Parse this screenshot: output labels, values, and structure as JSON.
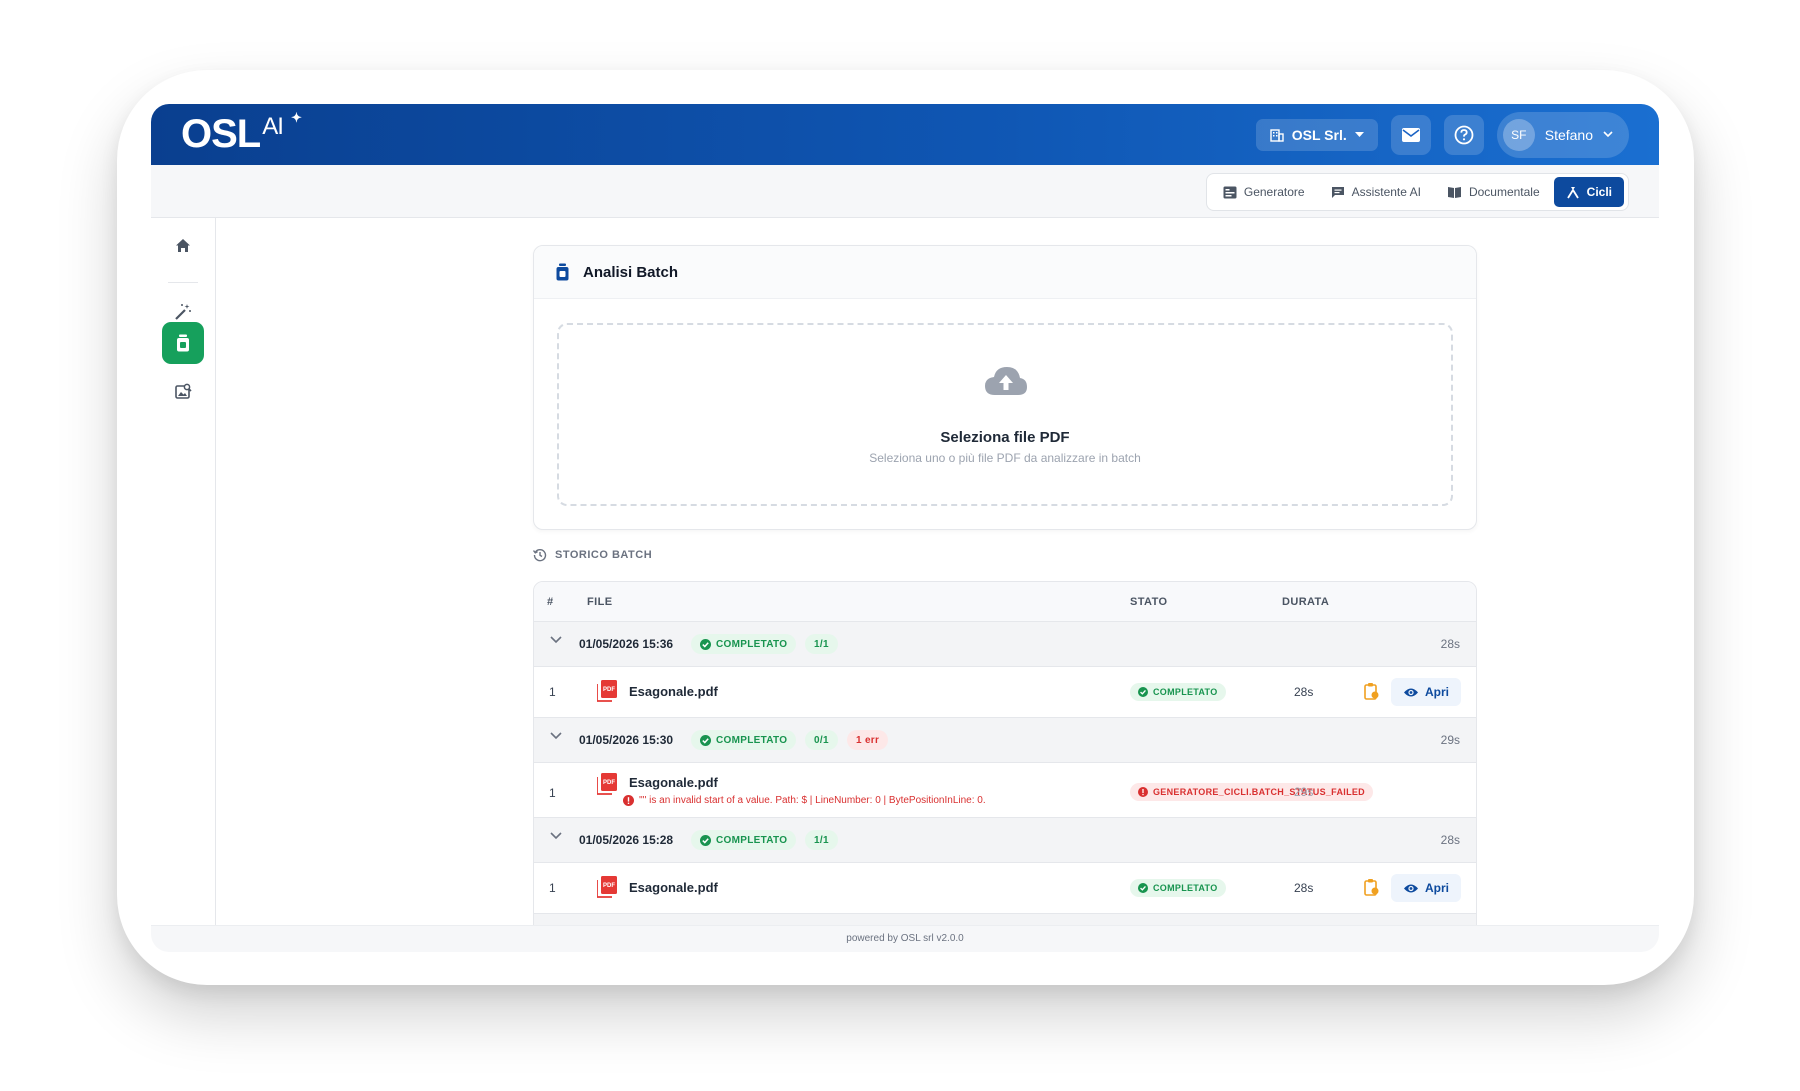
{
  "header": {
    "logo_text": "OSL",
    "logo_sup": "AI",
    "company": "OSL Srl.",
    "user_initials": "SF",
    "user_name": "Stefano"
  },
  "modes": [
    {
      "label": "Generatore",
      "icon": "form-icon",
      "active": false
    },
    {
      "label": "Assistente AI",
      "icon": "chat-icon",
      "active": false
    },
    {
      "label": "Documentale",
      "icon": "book-icon",
      "active": false
    },
    {
      "label": "Cicli",
      "icon": "cycle-icon",
      "active": true
    }
  ],
  "sidebar": {
    "items": [
      {
        "icon": "home-icon"
      },
      {
        "icon": "magic-wand-icon"
      },
      {
        "icon": "batch-icon",
        "active": true
      },
      {
        "icon": "image-search-icon"
      }
    ]
  },
  "card": {
    "title": "Analisi Batch",
    "upload_title": "Seleziona file PDF",
    "upload_subtitle": "Seleziona uno o più file PDF da analizzare in batch"
  },
  "history": {
    "title": "STORICO BATCH",
    "columns": {
      "num": "#",
      "file": "FILE",
      "status": "STATO",
      "duration": "DURATA"
    },
    "groups": [
      {
        "timestamp": "01/05/2026 15:36",
        "status": "COMPLETATO",
        "count": "1/1",
        "errors": "",
        "duration": "28s",
        "rows": [
          {
            "num": "1",
            "file": "Esagonale.pdf",
            "status": "COMPLETATO",
            "duration": "28s",
            "action": "Apri",
            "error": ""
          }
        ]
      },
      {
        "timestamp": "01/05/2026 15:30",
        "status": "COMPLETATO",
        "count": "0/1",
        "errors": "1 err",
        "duration": "29s",
        "rows": [
          {
            "num": "1",
            "file": "Esagonale.pdf",
            "status": "GENERATORE_CICLI.BATCH_STATUS_FAILED",
            "duration": "29s",
            "action": "",
            "error": "'\"' is an invalid start of a value. Path: $ | LineNumber: 0 | BytePositionInLine: 0."
          }
        ]
      },
      {
        "timestamp": "01/05/2026 15:28",
        "status": "COMPLETATO",
        "count": "1/1",
        "errors": "",
        "duration": "28s",
        "rows": [
          {
            "num": "1",
            "file": "Esagonale.pdf",
            "status": "COMPLETATO",
            "duration": "28s",
            "action": "Apri",
            "error": ""
          }
        ]
      }
    ]
  },
  "footer": {
    "text": "powered by OSL srl v2.0.0"
  },
  "colors": {
    "brand_blue": "#0d4a9e",
    "green": "#16a05c",
    "red": "#d93030"
  }
}
